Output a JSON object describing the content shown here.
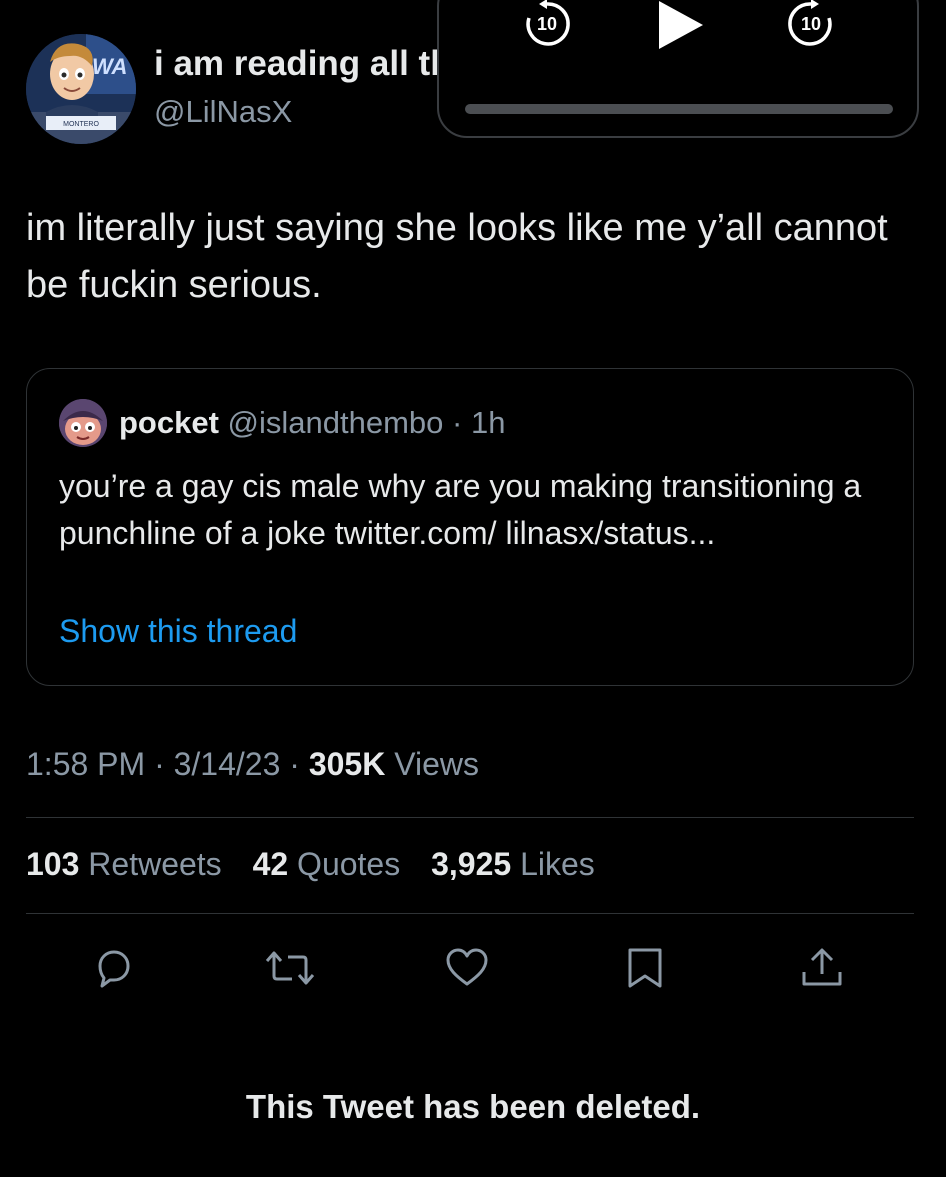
{
  "author": {
    "display_name": "i am reading all tl",
    "handle": "@LilNasX",
    "avatar_icon": "cartoon-news-anchor-avatar",
    "avatar_caption": "MONTERO",
    "avatar_wall_text": "WA"
  },
  "player": {
    "rewind_seconds": "10",
    "forward_seconds": "10",
    "play_icon": "play-icon",
    "progress": 0
  },
  "tweet": {
    "text": "im literally just saying she looks like me y’all cannot be fuckin serious."
  },
  "quoted_tweet": {
    "name": "pocket",
    "meta": "@islandthembo · 1h",
    "text": "you’re a gay cis male why are you making transitioning a punchline of a joke twitter.com/ lilnasx/status...",
    "show_thread": "Show this thread"
  },
  "meta": {
    "time": "1:58 PM",
    "separator": "·",
    "date": "3/14/23",
    "views_count": "305K",
    "views_label": "Views"
  },
  "stats": {
    "retweets_count": "103",
    "retweets_label": "Retweets",
    "quotes_count": "42",
    "quotes_label": "Quotes",
    "likes_count": "3,925",
    "likes_label": "Likes"
  },
  "actions": [
    "reply-icon",
    "retweet-icon",
    "like-icon",
    "bookmark-icon",
    "share-icon"
  ],
  "colors": {
    "background": "#000000",
    "text_primary": "#e7e9ea",
    "text_secondary": "#8b98a5",
    "link": "#1d9bf0",
    "border": "#2f3336"
  },
  "footer": {
    "deleted_notice": "This Tweet has been deleted."
  }
}
